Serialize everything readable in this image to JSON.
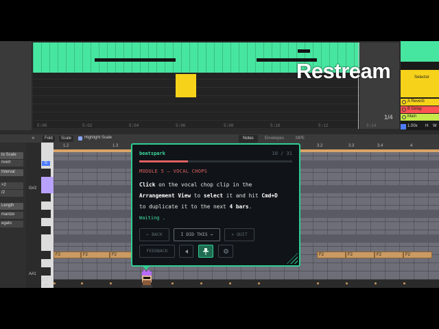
{
  "overlay": {
    "watermark": "Restream"
  },
  "arrangement": {
    "ruler_ticks": [
      "5:00",
      "5:02",
      "5:04",
      "5:06",
      "5:08",
      "5:10",
      "5:12",
      "5:14"
    ],
    "zoom_ratio": "1/4",
    "colors": {
      "clip_green": "#47e6a0",
      "clip_yellow": "#f7d21a"
    }
  },
  "track_panel": {
    "selector_label": "Selector",
    "sends": [
      {
        "label": "A Reverb"
      },
      {
        "label": "B Delay"
      },
      {
        "label": "Main"
      }
    ],
    "tempo_value": "1.00x",
    "h_label": "H",
    "w_label": "W"
  },
  "editor_toolbar": {
    "fold_label": "Fold",
    "scale_label": "Scale",
    "highlight_scale_label": "Highlight Scale",
    "highlight_scale_checked": true,
    "tabs": [
      "Notes",
      "Envelopes",
      "MPE"
    ],
    "active_tab": "Notes"
  },
  "editor_left": {
    "items": [
      "to Scale",
      "nvert",
      "Interval",
      "×2",
      "/2",
      "Length",
      "manize",
      "egato"
    ]
  },
  "piano_roll": {
    "pitch_labels": {
      "g_sharp": "G#2",
      "a_sharp": "A#1",
      "velocity_top": "127",
      "velocity_mid": "64"
    },
    "lane_tag": "G",
    "ruler_labels": [
      "1.2",
      "1.3",
      "3.2",
      "3.3",
      "3.4",
      "4"
    ],
    "note_label": "F2",
    "note_color": "#c99a62"
  },
  "tutorial": {
    "brand": "beatspark",
    "step": "10 / 31",
    "progress": 0.32,
    "module_title": "MODULE 5 — VOCAL CHOPS",
    "text": {
      "w1": "Click",
      "w2": " on the vocal chop clip in the",
      "w3": "Arrangement View",
      "w4": " to ",
      "w5": "select",
      "w6": " it and hit ",
      "w7": "Cmd+D",
      "w8": "to duplicate it to the next ",
      "w9": "4 bars",
      "w10": "."
    },
    "status": "Waiting  .",
    "buttons": {
      "back": "← BACK",
      "done": "I DID THIS →",
      "quit": "× QUIT",
      "feedback": "FEEDBACK"
    },
    "icons": {
      "sound": "speaker-icon",
      "pin": "pin-icon",
      "settings": "gear-icon"
    },
    "accent_color": "#2fcf93",
    "module_color": "#e06262"
  }
}
